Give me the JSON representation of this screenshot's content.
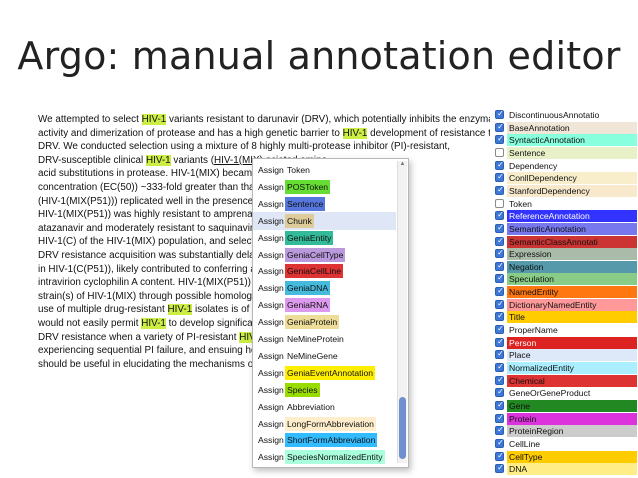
{
  "slide": {
    "title": "Argo: manual annotation editor"
  },
  "document_lines": [
    [
      {
        "t": "We attempted to select "
      },
      {
        "t": "HIV-1",
        "c": "hl"
      },
      {
        "t": " variants resistant to darunavir (DRV), which potentially inhibits the enzymatic"
      }
    ],
    [
      {
        "t": "activity and dimerization of protease and has a high genetic barrier to "
      },
      {
        "t": "HIV-1",
        "c": "hl"
      },
      {
        "t": " development of resistance to"
      }
    ],
    [
      {
        "t": "DRV. We conducted selection using a mixture of 8 highly multi-protease inhibitor (PI)-resistant,"
      }
    ],
    [
      {
        "t": "DRV-susceptible clinical "
      },
      {
        "t": "HIV-1",
        "c": "hl"
      },
      {
        "t": " variants ("
      },
      {
        "t": "HIV-1(MIX)",
        "c": "ul"
      },
      {
        "t": "                                             ociated amino"
      }
    ],
    [
      {
        "t": "acid substitutions in protease. HIV-1(MIX) became                                                 ective"
      }
    ],
    [
      {
        "t": "concentration (EC(50)) ~333-fold greater than that                                                  assage 51"
      }
    ],
    [
      {
        "t": "(HIV-1(MIX(P51))) replicated well in the presence o                                                  -resistant"
      }
    ],
    [
      {
        "t": "HIV-1(MIX(P51)) was highly resistant to amprenavir                                                  r, and"
      }
    ],
    [
      {
        "t": "atazanavir and moderately resistant to saquinavir a                                                  esemblance with"
      }
    ],
    [
      {
        "t": "HIV-1(C) of the HIV-1(MIX) population, and selectio                                                  however, its"
      }
    ],
    [
      {
        "t": "DRV resistance acquisition was substantially delaye                                                  s in Gag, lacking"
      }
    ],
    [
      {
        "t": "in HIV-1(C(P51)), likely contributed to conferring a r                                                  1)) by reducing"
      }
    ],
    [
      {
        "t": "intravirion cyclophilin A content. HIV-1(MIX(P51)) ap                                                  m another "
      },
      {
        "t": "HIV-1",
        "c": "hl-yellow"
      }
    ],
    [
      {
        "t": "strain(s) of HIV-1(MIX) through possible homologou                                                  ggest that the"
      }
    ],
    [
      {
        "t": "use of multiple drug-resistant "
      },
      {
        "t": "HIV-1",
        "c": "hl"
      },
      {
        "t": " isolates is of uti                                                  and that DRV"
      }
    ],
    [
      {
        "t": "would not easily permit "
      },
      {
        "t": "HIV-1",
        "c": "hl"
      },
      {
        "t": " to develop significant                                                  p high levels of"
      }
    ],
    [
      {
        "t": "DRV resistance when a variety of PI-resistant "
      },
      {
        "t": "HIV-1",
        "c": "hl"
      },
      {
        "t": "                                                  ents"
      }
    ],
    [
      {
        "t": "experiencing sequential PI failure, and ensuing hom                                                  IV-1(MIX(P51))"
      }
    ],
    [
      {
        "t": "should be useful in elucidating the mechanisms of H                                                  gents."
      }
    ]
  ],
  "menu": {
    "verb": "Assign",
    "items": [
      {
        "label": "Token",
        "bg": "#ffffff"
      },
      {
        "label": "POSToken",
        "bg": "#66dd33"
      },
      {
        "label": "Sentence",
        "bg": "#5577dd"
      },
      {
        "label": "Chunk",
        "bg": "#ddcc99",
        "selected": true
      },
      {
        "label": "GeniaEntity",
        "bg": "#33bb99"
      },
      {
        "label": "GeniaCellType",
        "bg": "#bb99dd"
      },
      {
        "label": "GeniaCellLine",
        "bg": "#dd3333"
      },
      {
        "label": "GeniaDNA",
        "bg": "#44bbdd"
      },
      {
        "label": "GeniaRNA",
        "bg": "#dd99ee"
      },
      {
        "label": "GeniaProtein",
        "bg": "#eedd99"
      },
      {
        "label": "NeMineProtein",
        "bg": "#ffffff"
      },
      {
        "label": "NeMineGene",
        "bg": "#ffffff"
      },
      {
        "label": "GeniaEventAnnotation",
        "bg": "#ffee00"
      },
      {
        "label": "Species",
        "bg": "#99dd00"
      },
      {
        "label": "Abbreviation",
        "bg": "#ffffff"
      },
      {
        "label": "LongFormAbbreviation",
        "bg": "#ffeecc"
      },
      {
        "label": "ShortFormAbbreviation",
        "bg": "#33bbff"
      },
      {
        "label": "SpeciesNormalizedEntity",
        "bg": "#aaffdd"
      }
    ]
  },
  "type_list": [
    {
      "label": "DiscontinuousAnnotatio",
      "bg": "#ffffff",
      "checked": true
    },
    {
      "label": "BaseAnnotation",
      "bg": "#f0e6d8",
      "checked": true
    },
    {
      "label": "SyntacticAnnotation",
      "bg": "#88ffdd",
      "checked": true
    },
    {
      "label": "Sentence",
      "bg": "#e8f0c8",
      "checked": false
    },
    {
      "label": "Dependency",
      "bg": "#ffffff",
      "checked": true
    },
    {
      "label": "ConllDependency",
      "bg": "#f8eecc",
      "checked": true
    },
    {
      "label": "StanfordDependency",
      "bg": "#f8e8cc",
      "checked": true
    },
    {
      "label": "Token",
      "bg": "#ffffff",
      "checked": false
    },
    {
      "label": "ReferenceAnnotation",
      "bg": "#3333ff",
      "checked": true,
      "fg": "#ffffff"
    },
    {
      "label": "SemanticAnnotation",
      "bg": "#7777ee",
      "checked": true
    },
    {
      "label": "SemanticClassAnnotati",
      "bg": "#cc3333",
      "checked": true
    },
    {
      "label": "Expression",
      "bg": "#aabbaa",
      "checked": true
    },
    {
      "label": "Negation",
      "bg": "#5599aa",
      "checked": true
    },
    {
      "label": "Speculation",
      "bg": "#88cc88",
      "checked": true
    },
    {
      "label": "NamedEntity",
      "bg": "#ff7711",
      "checked": true
    },
    {
      "label": "DictionaryNamedEntity",
      "bg": "#ff9999",
      "checked": true
    },
    {
      "label": "Title",
      "bg": "#ffcc00",
      "checked": true
    },
    {
      "label": "ProperName",
      "bg": "#ffffff",
      "checked": true
    },
    {
      "label": "Person",
      "bg": "#dd2222",
      "checked": true,
      "fg": "#ffffff"
    },
    {
      "label": "Place",
      "bg": "#dde8f8",
      "checked": true
    },
    {
      "label": "NormalizedEntity",
      "bg": "#aaeeff",
      "checked": true
    },
    {
      "label": "Chemical",
      "bg": "#dd3333",
      "checked": true
    },
    {
      "label": "GeneOrGeneProduct",
      "bg": "#ffffff",
      "checked": true
    },
    {
      "label": "Gene",
      "bg": "#228822",
      "checked": true
    },
    {
      "label": "Protein",
      "bg": "#dd33dd",
      "checked": true
    },
    {
      "label": "ProteinRegion",
      "bg": "#cccccc",
      "checked": true
    },
    {
      "label": "CellLine",
      "bg": "#ffffff",
      "checked": true
    },
    {
      "label": "CellType",
      "bg": "#ffcc00",
      "checked": true
    },
    {
      "label": "DNA",
      "bg": "#ffee88",
      "checked": true
    }
  ]
}
